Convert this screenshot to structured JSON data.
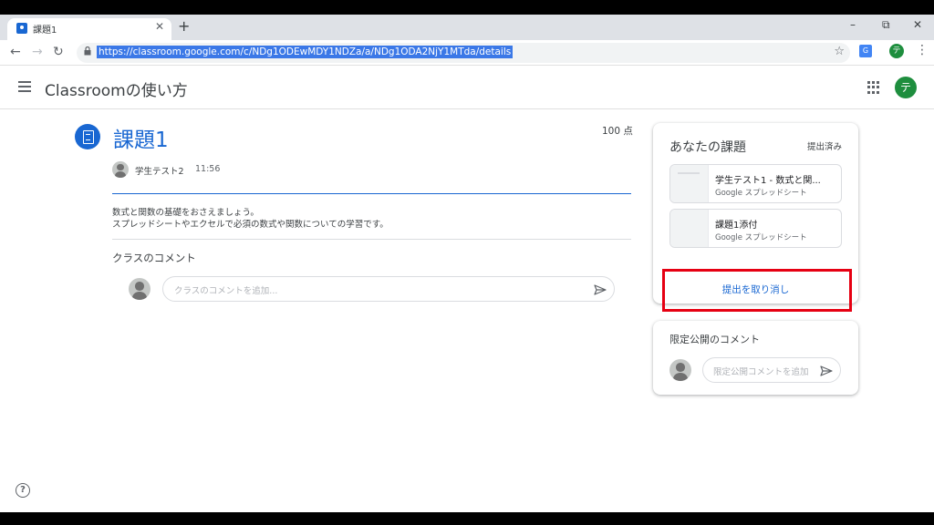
{
  "browser": {
    "tab_title": "課題1",
    "new_tab_label": "+",
    "tab_close": "✕",
    "url": "https://classroom.google.com/c/NDg1ODEwMDY1NDZa/a/NDg1ODA2NjY1MTda/details",
    "profile_initial": "テ",
    "translate_glyph": "G",
    "window_controls": {
      "minimize": "–",
      "restore": "⧉",
      "close": "✕"
    },
    "nav": {
      "back": "←",
      "forward": "→",
      "reload": "↻",
      "star": "☆",
      "menu": "⋮"
    }
  },
  "app": {
    "title": "Classroomの使い方",
    "avatar_initial": "テ"
  },
  "assignment": {
    "title": "課題1",
    "points": "100 点",
    "author": "学生テスト2",
    "time": "11:56",
    "description_line1": "数式と関数の基礎をおさえましょう。",
    "description_line2": "スプレッドシートやエクセルで必須の数式や関数についての学習です。"
  },
  "class_comments": {
    "title": "クラスのコメント",
    "placeholder": "クラスのコメントを追加..."
  },
  "your_work": {
    "title": "あなたの課題",
    "status": "提出済み",
    "attachments": [
      {
        "name": "学生テスト1 - 数式と関...",
        "type": "Google スプレッドシート"
      },
      {
        "name": "課題1添付",
        "type": "Google スプレッドシート"
      }
    ],
    "unsubmit_label": "提出を取り消し",
    "highlight_color": "#e60012"
  },
  "private_comments": {
    "title": "限定公開のコメント",
    "placeholder": "限定公開コメントを追加"
  },
  "help": {
    "glyph": "?"
  },
  "colors": {
    "accent": "#1967d2",
    "avatar_green": "#1e8e3e"
  }
}
